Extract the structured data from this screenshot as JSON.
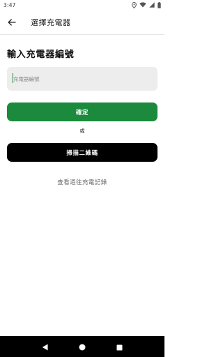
{
  "status_bar": {
    "time": "3:47",
    "icons": [
      "location-icon",
      "wifi-icon",
      "signal-icon",
      "battery-icon"
    ]
  },
  "app_bar": {
    "back_icon": "arrow-left-icon",
    "title": "選擇充電器"
  },
  "main": {
    "heading": "輸入充電器編號",
    "charger_input": {
      "value": "",
      "placeholder": "充電器編號"
    },
    "confirm_label": "確定",
    "or_label": "或",
    "scan_label": "掃描二維碼",
    "history_label": "查看過往充電記錄"
  },
  "nav_bar": {
    "icons": [
      "back-triangle-icon",
      "home-circle-icon",
      "recents-square-icon"
    ]
  },
  "colors": {
    "accent": "#1b8a3c",
    "scan_button": "#000000",
    "input_bg": "#ededed"
  }
}
